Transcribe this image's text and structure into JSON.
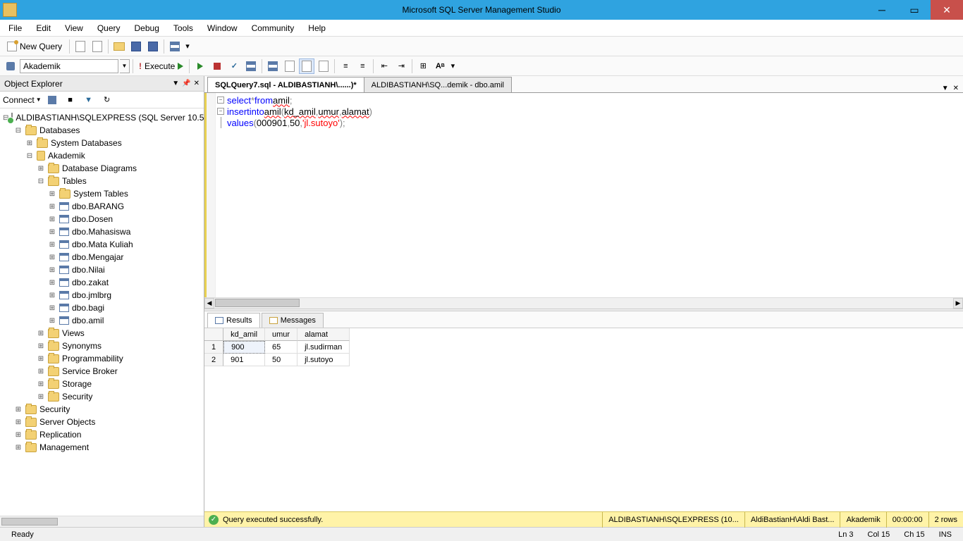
{
  "title": "Microsoft SQL Server Management Studio",
  "menu": [
    "File",
    "Edit",
    "View",
    "Query",
    "Debug",
    "Tools",
    "Window",
    "Community",
    "Help"
  ],
  "toolbar1": {
    "newquery": "New Query"
  },
  "toolbar2": {
    "dbcombo": "Akademik",
    "execute": "Execute"
  },
  "panel": {
    "title": "Object Explorer",
    "connect": "Connect",
    "tree": {
      "server": "ALDIBASTIANH\\SQLEXPRESS (SQL Server 10.5",
      "databases": "Databases",
      "sysdb": "System Databases",
      "userdb": "Akademik",
      "dbdiag": "Database Diagrams",
      "tables": "Tables",
      "systables": "System Tables",
      "tlist": [
        "dbo.BARANG",
        "dbo.Dosen",
        "dbo.Mahasiswa",
        "dbo.Mata Kuliah",
        "dbo.Mengajar",
        "dbo.Nilai",
        "dbo.zakat",
        "dbo.jmlbrg",
        "dbo.bagi",
        "dbo.amil"
      ],
      "views": "Views",
      "synonyms": "Synonyms",
      "prog": "Programmability",
      "sbroker": "Service Broker",
      "storage": "Storage",
      "security": "Security",
      "topsec": "Security",
      "srvobj": "Server Objects",
      "repl": "Replication",
      "mgmt": "Management"
    }
  },
  "tabs": {
    "active": "SQLQuery7.sql - ALDIBASTIANH\\......)*",
    "inactive": "ALDIBASTIANH\\SQ...demik - dbo.amil"
  },
  "code": {
    "l1_kw1": "select",
    "l1_star": " * ",
    "l1_kw2": "from",
    "l1_id": " amil",
    "l1_end": ";",
    "l2_kw1": "insert",
    "l2_kw2": " into",
    "l2_id1": " amil ",
    "l2_p1": "(",
    "l2_id2": "kd_amil",
    "l2_c1": ",",
    "l2_id3": "umur",
    "l2_c2": ",",
    "l2_id4": "alamat",
    "l2_p2": ")",
    "l3_kw": "values ",
    "l3_p1": "(",
    "l3_n1": "000901",
    "l3_c1": ",",
    "l3_n2": "50",
    "l3_c2": ",",
    "l3_str": "'jl.sutoyo'",
    "l3_p2": ")",
    "l3_end": ";"
  },
  "results": {
    "tab1": "Results",
    "tab2": "Messages",
    "cols": [
      "kd_amil",
      "umur",
      "alamat"
    ],
    "rows": [
      {
        "n": "1",
        "kd": "900",
        "umur": "65",
        "alamat": "jl.sudirman"
      },
      {
        "n": "2",
        "kd": "901",
        "umur": "50",
        "alamat": "jl.sutoyo"
      }
    ]
  },
  "qstatus": {
    "msg": "Query executed successfully.",
    "server": "ALDIBASTIANH\\SQLEXPRESS (10...",
    "user": "AldiBastianH\\Aldi Bast...",
    "db": "Akademik",
    "time": "00:00:00",
    "rows": "2 rows"
  },
  "status": {
    "ready": "Ready",
    "ln": "Ln 3",
    "col": "Col 15",
    "ch": "Ch 15",
    "ins": "INS"
  }
}
